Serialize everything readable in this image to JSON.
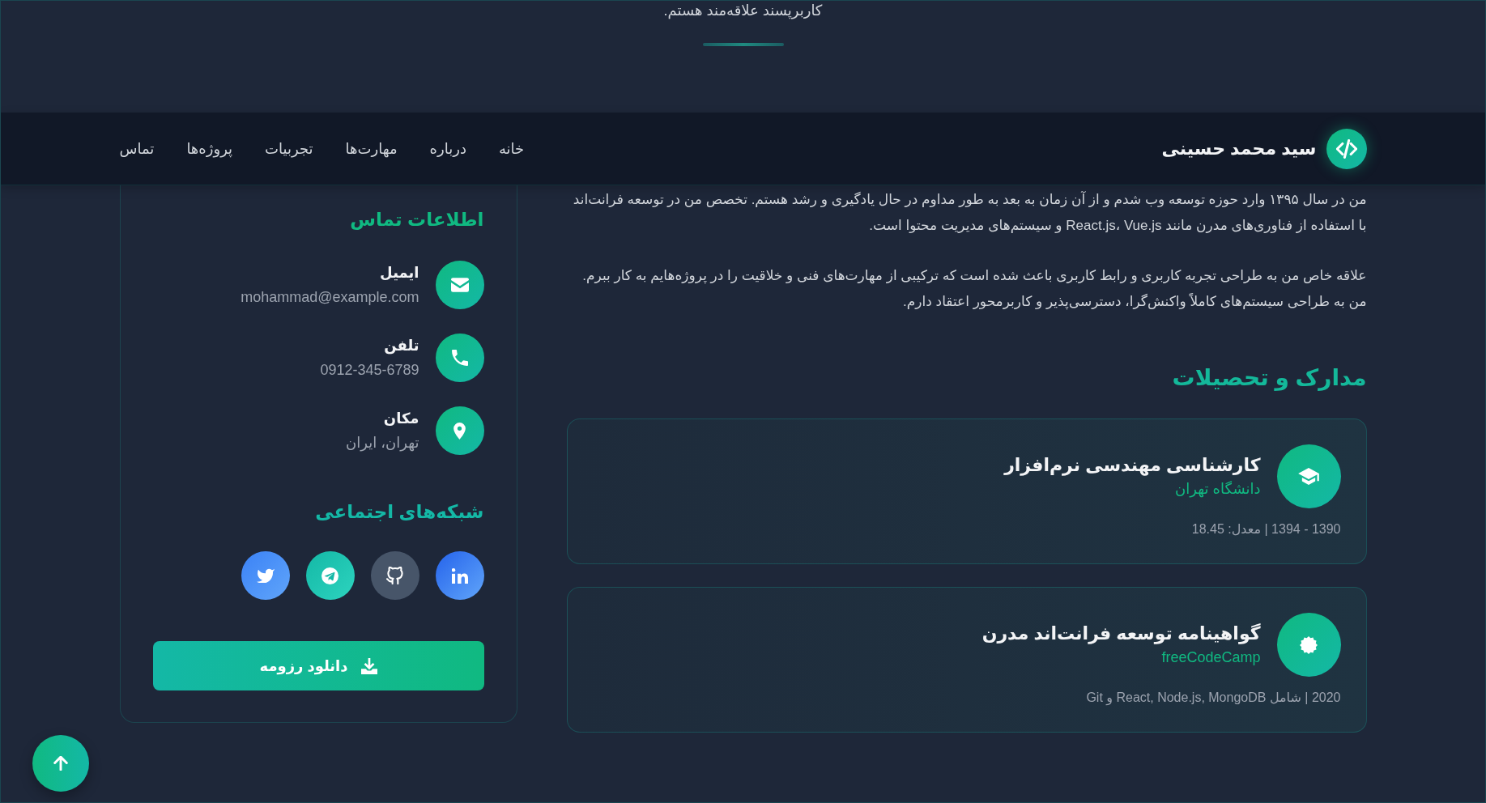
{
  "hero": {
    "text_end": "کاربرپسند علاقه‌مند هستم."
  },
  "navbar": {
    "title": "سید محمد حسینی",
    "links": [
      {
        "label": "خانه"
      },
      {
        "label": "درباره"
      },
      {
        "label": "مهارت‌ها"
      },
      {
        "label": "تجربیات"
      },
      {
        "label": "پروژه‌ها"
      },
      {
        "label": "تماس"
      }
    ]
  },
  "about": {
    "paragraphs": [
      "من در سال ۱۳۹۵ وارد حوزه توسعه وب شدم و از آن زمان به بعد به طور مداوم در حال یادگیری و رشد هستم. تخصص من در توسعه فرانت‌اند با استفاده از فناوری‌های مدرن مانند React.js، Vue.js و سیستم‌های مدیریت محتوا است.",
      "علاقه خاص من به طراحی تجربه کاربری و رابط کاربری باعث شده است که ترکیبی از مهارت‌های فنی و خلاقیت را در پروژه‌هایم به کار ببرم. من به طراحی سیستم‌های کاملاً واکنش‌گرا، دسترسی‌پذیر و کاربرمحور اعتقاد دارم."
    ]
  },
  "education": {
    "title": "مدارک و تحصیلات",
    "items": [
      {
        "kind": "degree",
        "title": "کارشناسی مهندسی نرم‌افزار",
        "institution": "دانشگاه تهران",
        "details": "1390 - 1394 | معدل: 18.45"
      },
      {
        "kind": "certificate",
        "title": "گواهینامه توسعه فرانت‌اند مدرن",
        "institution": "freeCodeCamp",
        "details": "2020 | شامل React, Node.js, MongoDB و Git"
      }
    ]
  },
  "contact": {
    "title": "اطلاعات تماس",
    "items": [
      {
        "kind": "email",
        "label": "ایمیل",
        "value": "mohammad@example.com"
      },
      {
        "kind": "phone",
        "label": "تلفن",
        "value": "0912-345-6789"
      },
      {
        "kind": "location",
        "label": "مکان",
        "value": "تهران، ایران"
      }
    ],
    "social_title": "شبکه‌های اجتماعی",
    "social": [
      {
        "kind": "linkedin"
      },
      {
        "kind": "github"
      },
      {
        "kind": "telegram"
      },
      {
        "kind": "twitter"
      }
    ],
    "download_button": "دانلود رزومه"
  }
}
